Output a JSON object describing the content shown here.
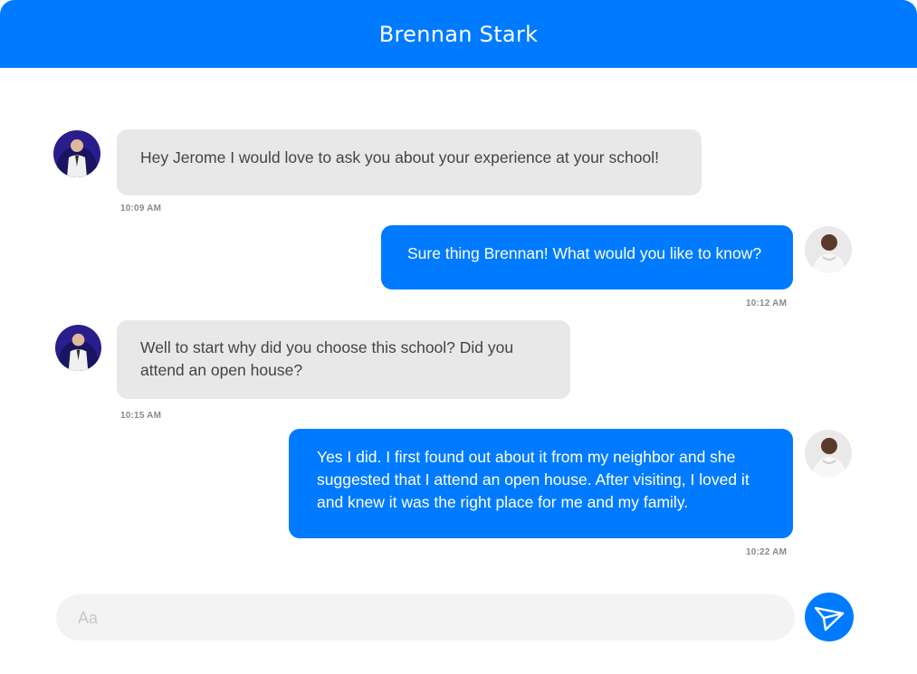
{
  "header": {
    "title": "Brennan Stark"
  },
  "messages": [
    {
      "direction": "incoming",
      "text": "Hey Jerome I would love to ask you about your experience  at your school!",
      "time": "10:09 AM"
    },
    {
      "direction": "outgoing",
      "text": "Sure thing Brennan! What would you like to know?",
      "time": "10:12 AM"
    },
    {
      "direction": "incoming",
      "text": "Well to start why did you choose this school? Did you attend an open house?",
      "time": "10:15 AM"
    },
    {
      "direction": "outgoing",
      "text": "Yes I did. I first found out about it from my neighbor and she suggested that I attend an open house. After visiting, I loved it and knew it was the right place for me and my family.",
      "time": "10:22 AM"
    }
  ],
  "composer": {
    "placeholder": "Aa",
    "value": ""
  },
  "icons": {
    "send": "paper-plane-icon"
  },
  "colors": {
    "accent": "#007bff",
    "incoming_bubble": "#e8e8e8",
    "outgoing_text": "#ffffff"
  }
}
